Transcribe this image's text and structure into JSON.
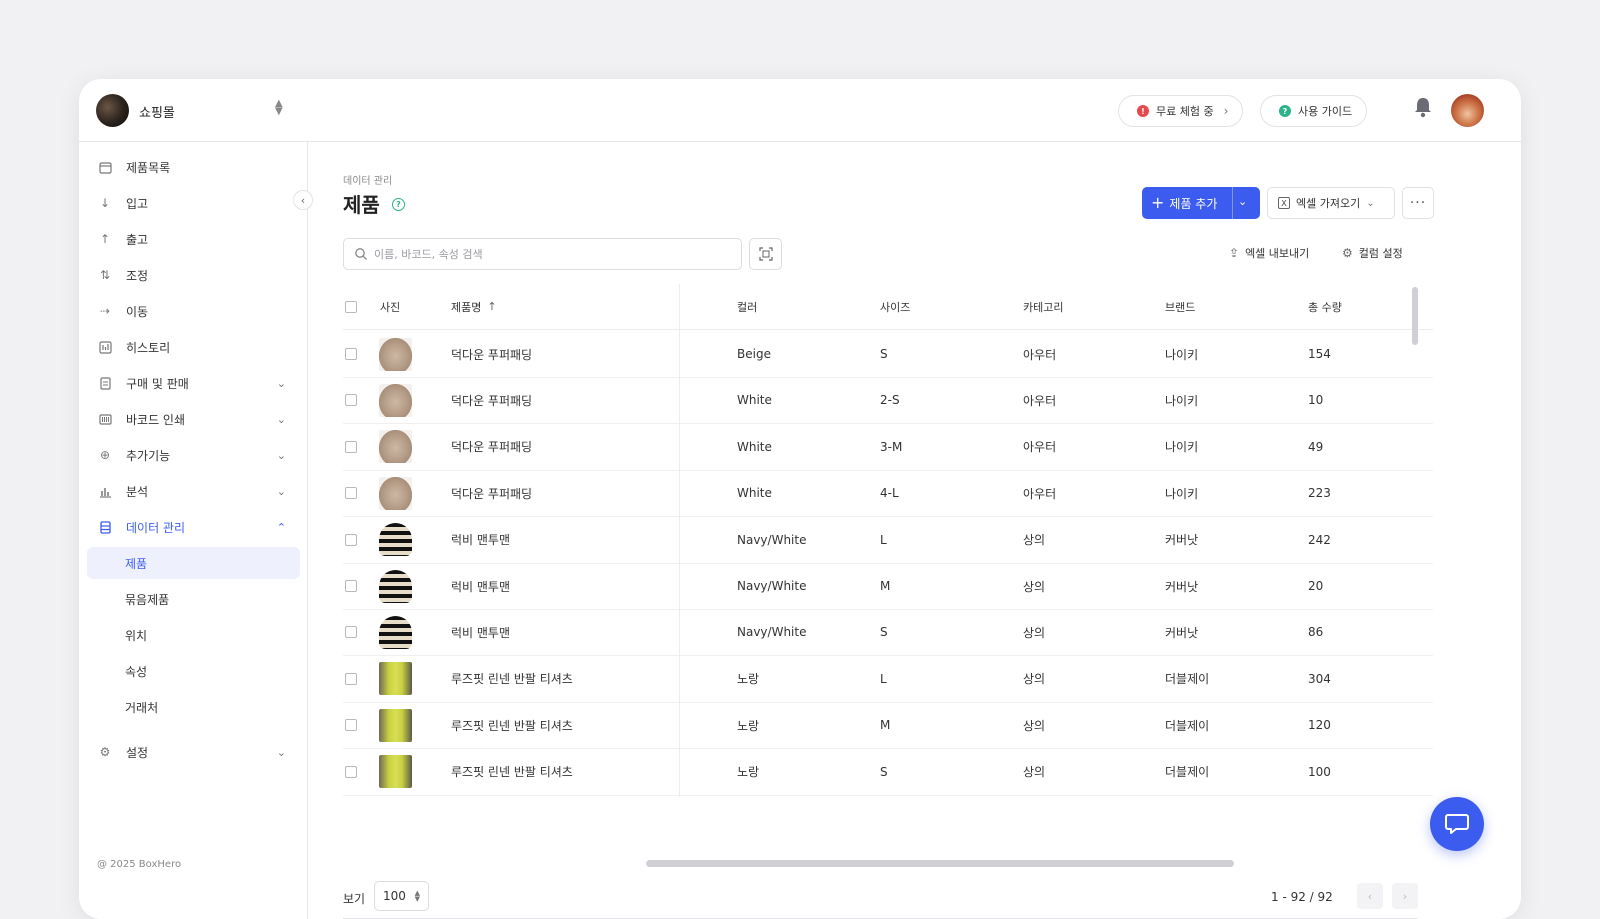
{
  "store": {
    "name": "쇼핑몰"
  },
  "header": {
    "trial_label": "무료 체험 중",
    "guide_label": "사용 가이드"
  },
  "sidebar": {
    "items": [
      {
        "label": "제품목록",
        "icon": "box-icon"
      },
      {
        "label": "입고",
        "icon": "arrow-down-icon"
      },
      {
        "label": "출고",
        "icon": "arrow-up-icon"
      },
      {
        "label": "조정",
        "icon": "adjust-icon"
      },
      {
        "label": "이동",
        "icon": "arrow-right-icon"
      },
      {
        "label": "히스토리",
        "icon": "history-icon"
      },
      {
        "label": "구매 및 판매",
        "icon": "document-icon"
      },
      {
        "label": "바코드 인쇄",
        "icon": "barcode-icon"
      },
      {
        "label": "추가기능",
        "icon": "plus-circle-icon"
      },
      {
        "label": "분석",
        "icon": "chart-icon"
      },
      {
        "label": "데이터 관리",
        "icon": "database-icon"
      }
    ],
    "data_sub": [
      "제품",
      "묶음제품",
      "위치",
      "속성",
      "거래처"
    ],
    "settings_label": "설정",
    "copyright": "@ 2025 BoxHero"
  },
  "main": {
    "breadcrumb": "데이터 관리",
    "title": "제품",
    "add_button": "제품 추가",
    "import_button": "엑셀 가져오기",
    "search_placeholder": "이름, 바코드, 속성 검색",
    "export_button": "엑셀 내보내기",
    "columns_button": "컬럼 설정"
  },
  "table": {
    "headers": [
      "사진",
      "제품명",
      "컬러",
      "사이즈",
      "카테고리",
      "브랜드",
      "총 수량"
    ],
    "rows": [
      {
        "thumb": "padding",
        "name": "덕다운 푸퍼패딩",
        "color": "Beige",
        "size": "S",
        "category": "아우터",
        "brand": "나이키",
        "qty": "154"
      },
      {
        "thumb": "padding",
        "name": "덕다운 푸퍼패딩",
        "color": "White",
        "size": "2-S",
        "category": "아우터",
        "brand": "나이키",
        "qty": "10"
      },
      {
        "thumb": "padding",
        "name": "덕다운 푸퍼패딩",
        "color": "White",
        "size": "3-M",
        "category": "아우터",
        "brand": "나이키",
        "qty": "49"
      },
      {
        "thumb": "padding",
        "name": "덕다운 푸퍼패딩",
        "color": "White",
        "size": "4-L",
        "category": "아우터",
        "brand": "나이키",
        "qty": "223"
      },
      {
        "thumb": "rugby",
        "name": "럭비 맨투맨",
        "color": "Navy/White",
        "size": "L",
        "category": "상의",
        "brand": "커버낫",
        "qty": "242"
      },
      {
        "thumb": "rugby",
        "name": "럭비 맨투맨",
        "color": "Navy/White",
        "size": "M",
        "category": "상의",
        "brand": "커버낫",
        "qty": "20"
      },
      {
        "thumb": "rugby",
        "name": "럭비 맨투맨",
        "color": "Navy/White",
        "size": "S",
        "category": "상의",
        "brand": "커버낫",
        "qty": "86"
      },
      {
        "thumb": "linen",
        "name": "루즈핏 린넨 반팔 티셔츠",
        "color": "노랑",
        "size": "L",
        "category": "상의",
        "brand": "더블제이",
        "qty": "304"
      },
      {
        "thumb": "linen",
        "name": "루즈핏 린넨 반팔 티셔츠",
        "color": "노랑",
        "size": "M",
        "category": "상의",
        "brand": "더블제이",
        "qty": "120"
      },
      {
        "thumb": "linen",
        "name": "루즈핏 린넨 반팔 티셔츠",
        "color": "노랑",
        "size": "S",
        "category": "상의",
        "brand": "더블제이",
        "qty": "100"
      }
    ]
  },
  "footer": {
    "page_size_label": "보기",
    "page_size": "100",
    "range": "1 - 92 / 92"
  },
  "colors": {
    "accent": "#3c5cf0",
    "trial_dot": "#e5484d",
    "guide_dot": "#2bb38a"
  }
}
